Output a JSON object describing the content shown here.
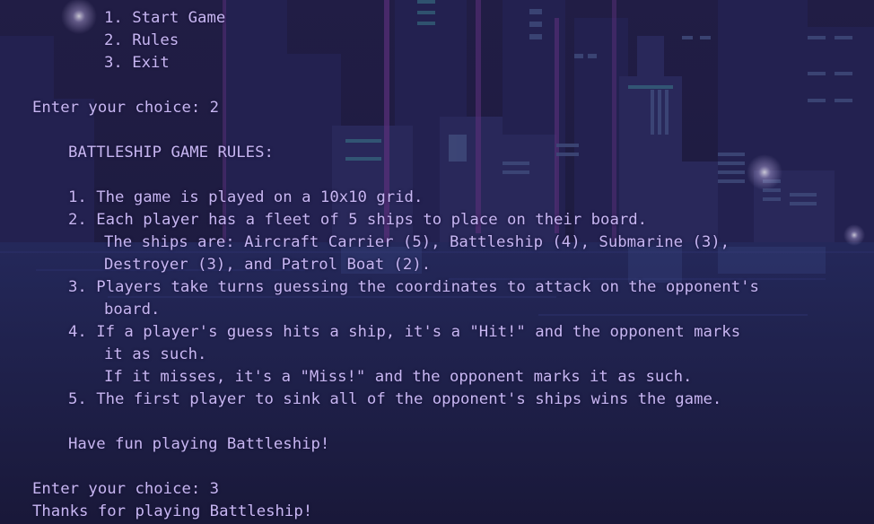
{
  "theme": {
    "text_color": "#c7b6f2",
    "background_color": "#1c1a3c",
    "skyline_color": "#2a2852",
    "window_light_color": "#3f4a7a",
    "neon_purple": "#5a2f7a",
    "neon_cyan": "#3a7a8a"
  },
  "menu": {
    "option_1": "1. Start Game",
    "option_2": "2. Rules",
    "option_3": "3. Exit"
  },
  "prompt_1": "Enter your choice: 2",
  "rules": {
    "heading": "BATTLESHIP GAME RULES:",
    "rule_1": "1. The game is played on a 10x10 grid.",
    "rule_2": "2. Each player has a fleet of 5 ships to place on their board.",
    "rule_2_cont_1": "The ships are: Aircraft Carrier (5), Battleship (4), Submarine (3),",
    "rule_2_cont_2": "Destroyer (3), and Patrol Boat (2).",
    "rule_3": "3. Players take turns guessing the coordinates to attack on the opponent's",
    "rule_3_cont": "board.",
    "rule_4": "4. If a player's guess hits a ship, it's a \"Hit!\" and the opponent marks",
    "rule_4_cont_1": "it as such.",
    "rule_4_cont_2": "If it misses, it's a \"Miss!\" and the opponent marks it as such.",
    "rule_5": "5. The first player to sink all of the opponent's ships wins the game.",
    "closing": "Have fun playing Battleship!"
  },
  "prompt_2": "Enter your choice: 3",
  "goodbye": "Thanks for playing Battleship!"
}
